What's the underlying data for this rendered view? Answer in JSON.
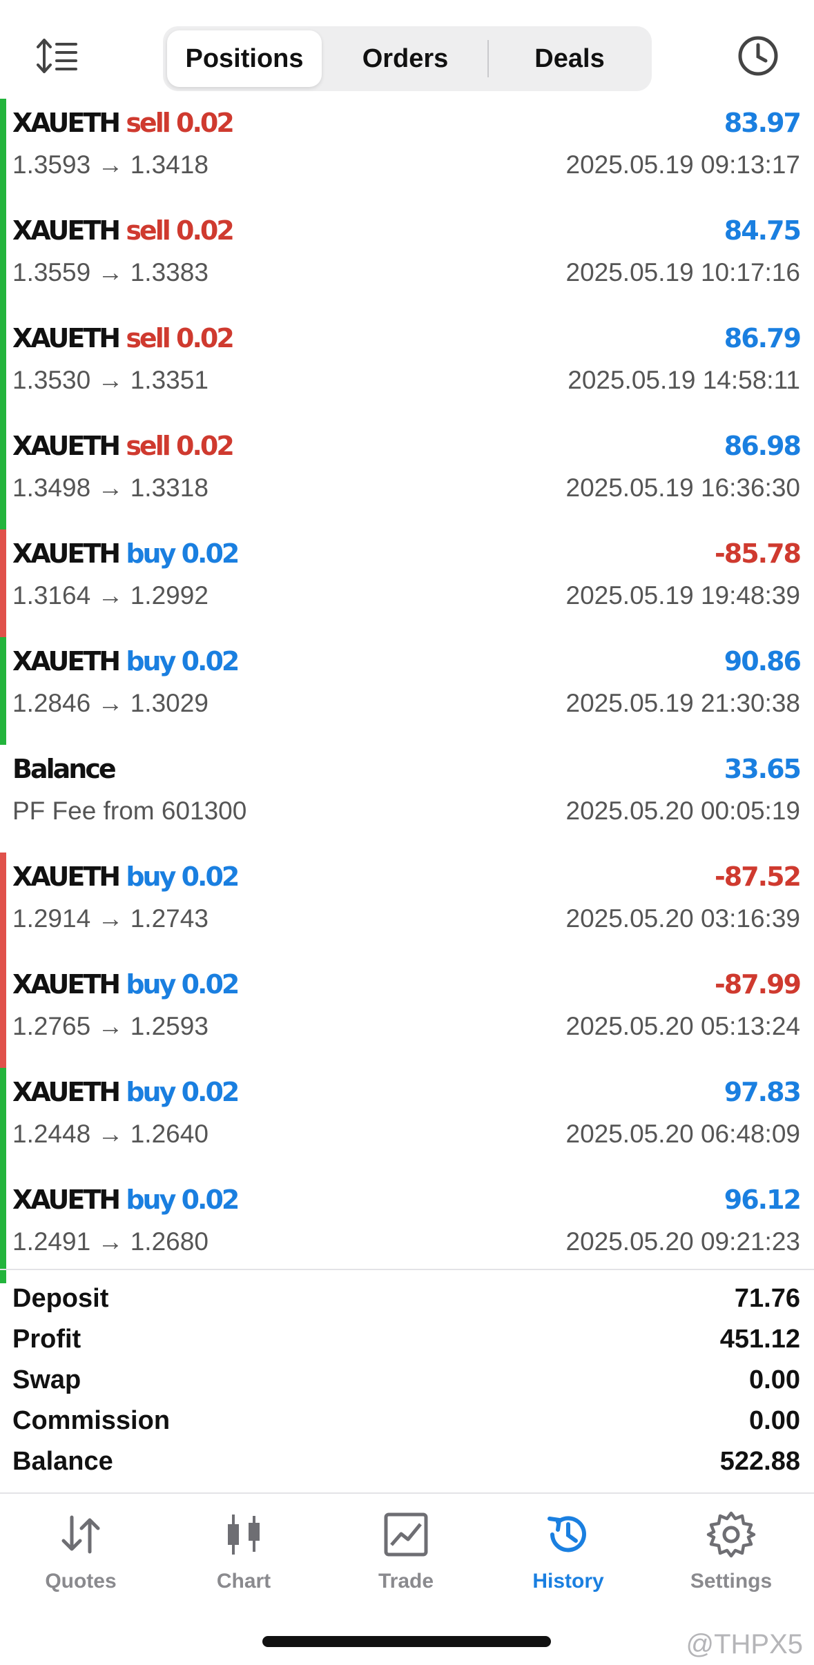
{
  "header": {
    "tabs": [
      {
        "label": "Positions",
        "active": true
      },
      {
        "label": "Orders",
        "active": false
      },
      {
        "label": "Deals",
        "active": false
      }
    ],
    "left_icon": "sort-icon",
    "right_icon": "clock-icon"
  },
  "rows": [
    {
      "symbol": "XAUETH",
      "side": "sell",
      "volume": "0.02",
      "prices": "1.3593 → 1.3418",
      "amount": "83.97",
      "time": "2025.05.19 09:13:17",
      "bar": "green"
    },
    {
      "symbol": "XAUETH",
      "side": "sell",
      "volume": "0.02",
      "prices": "1.3559 → 1.3383",
      "amount": "84.75",
      "time": "2025.05.19 10:17:16",
      "bar": "green"
    },
    {
      "symbol": "XAUETH",
      "side": "sell",
      "volume": "0.02",
      "prices": "1.3530 → 1.3351",
      "amount": "86.79",
      "time": "2025.05.19 14:58:11",
      "bar": "green"
    },
    {
      "symbol": "XAUETH",
      "side": "sell",
      "volume": "0.02",
      "prices": "1.3498 → 1.3318",
      "amount": "86.98",
      "time": "2025.05.19 16:36:30",
      "bar": "green"
    },
    {
      "symbol": "XAUETH",
      "side": "buy",
      "volume": "0.02",
      "prices": "1.3164 → 1.2992",
      "amount": "-85.78",
      "time": "2025.05.19 19:48:39",
      "bar": "red"
    },
    {
      "symbol": "XAUETH",
      "side": "buy",
      "volume": "0.02",
      "prices": "1.2846 → 1.3029",
      "amount": "90.86",
      "time": "2025.05.19 21:30:38",
      "bar": "green"
    },
    {
      "symbol": "Balance",
      "side": "",
      "volume": "",
      "prices": "PF Fee from 601300",
      "amount": "33.65",
      "time": "2025.05.20 00:05:19",
      "bar": "none"
    },
    {
      "symbol": "XAUETH",
      "side": "buy",
      "volume": "0.02",
      "prices": "1.2914 → 1.2743",
      "amount": "-87.52",
      "time": "2025.05.20 03:16:39",
      "bar": "red"
    },
    {
      "symbol": "XAUETH",
      "side": "buy",
      "volume": "0.02",
      "prices": "1.2765 → 1.2593",
      "amount": "-87.99",
      "time": "2025.05.20 05:13:24",
      "bar": "red"
    },
    {
      "symbol": "XAUETH",
      "side": "buy",
      "volume": "0.02",
      "prices": "1.2448 → 1.2640",
      "amount": "97.83",
      "time": "2025.05.20 06:48:09",
      "bar": "green"
    },
    {
      "symbol": "XAUETH",
      "side": "buy",
      "volume": "0.02",
      "prices": "1.2491 → 1.2680",
      "amount": "96.12",
      "time": "2025.05.20 09:21:23",
      "bar": "green"
    }
  ],
  "summary": [
    {
      "label": "Deposit",
      "value": "71.76"
    },
    {
      "label": "Profit",
      "value": "451.12"
    },
    {
      "label": "Swap",
      "value": "0.00"
    },
    {
      "label": "Commission",
      "value": "0.00"
    },
    {
      "label": "Balance",
      "value": "522.88"
    }
  ],
  "nav": [
    {
      "label": "Quotes",
      "icon": "quotes-arrows-icon",
      "active": false
    },
    {
      "label": "Chart",
      "icon": "candlestick-chart-icon",
      "active": false
    },
    {
      "label": "Trade",
      "icon": "trade-chart-icon",
      "active": false
    },
    {
      "label": "History",
      "icon": "history-clock-icon",
      "active": true
    },
    {
      "label": "Settings",
      "icon": "gear-icon",
      "active": false
    }
  ],
  "watermark": "@THPX5",
  "colors": {
    "accent_blue": "#1a7fe0",
    "sell_red": "#cf3a2f",
    "profit_bar_green": "#23b43c",
    "loss_bar_red": "#e0514b"
  }
}
